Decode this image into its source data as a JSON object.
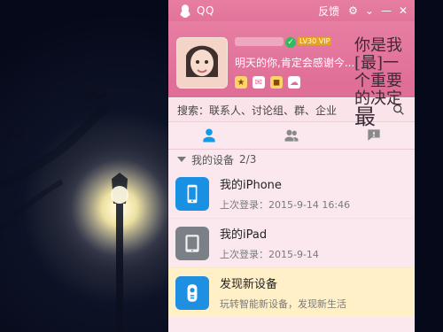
{
  "titlebar": {
    "app_name": "QQ",
    "feedback_label": "反馈"
  },
  "profile": {
    "signature": "明天的你,肯定会感谢今...",
    "handwriting": "你是我[最]一个重要的决定",
    "handwriting_emphasis": "最",
    "badges": [
      "LV30",
      "VIP"
    ]
  },
  "search": {
    "placeholder": "搜索：联系人、讨论组、群、企业"
  },
  "devices": {
    "group_label": "我的设备",
    "group_count": "2/3",
    "items": [
      {
        "name": "我的iPhone",
        "sub": "上次登录：2015-9-14 16:46"
      },
      {
        "name": "我的iPad",
        "sub": "上次登录：2015-9-14"
      },
      {
        "name": "发现新设备",
        "sub": "玩转智能新设备，发现新生活"
      }
    ]
  },
  "colors": {
    "accent_pink": "#e77ea2",
    "accent_blue": "#0f9be7",
    "highlight_bg": "#fff0c8"
  },
  "icons": {
    "tabs": [
      "contacts-icon",
      "group-icon",
      "message-icon"
    ],
    "search": "search-icon",
    "device_icons": [
      "phone-icon",
      "tablet-icon",
      "remote-icon"
    ]
  }
}
